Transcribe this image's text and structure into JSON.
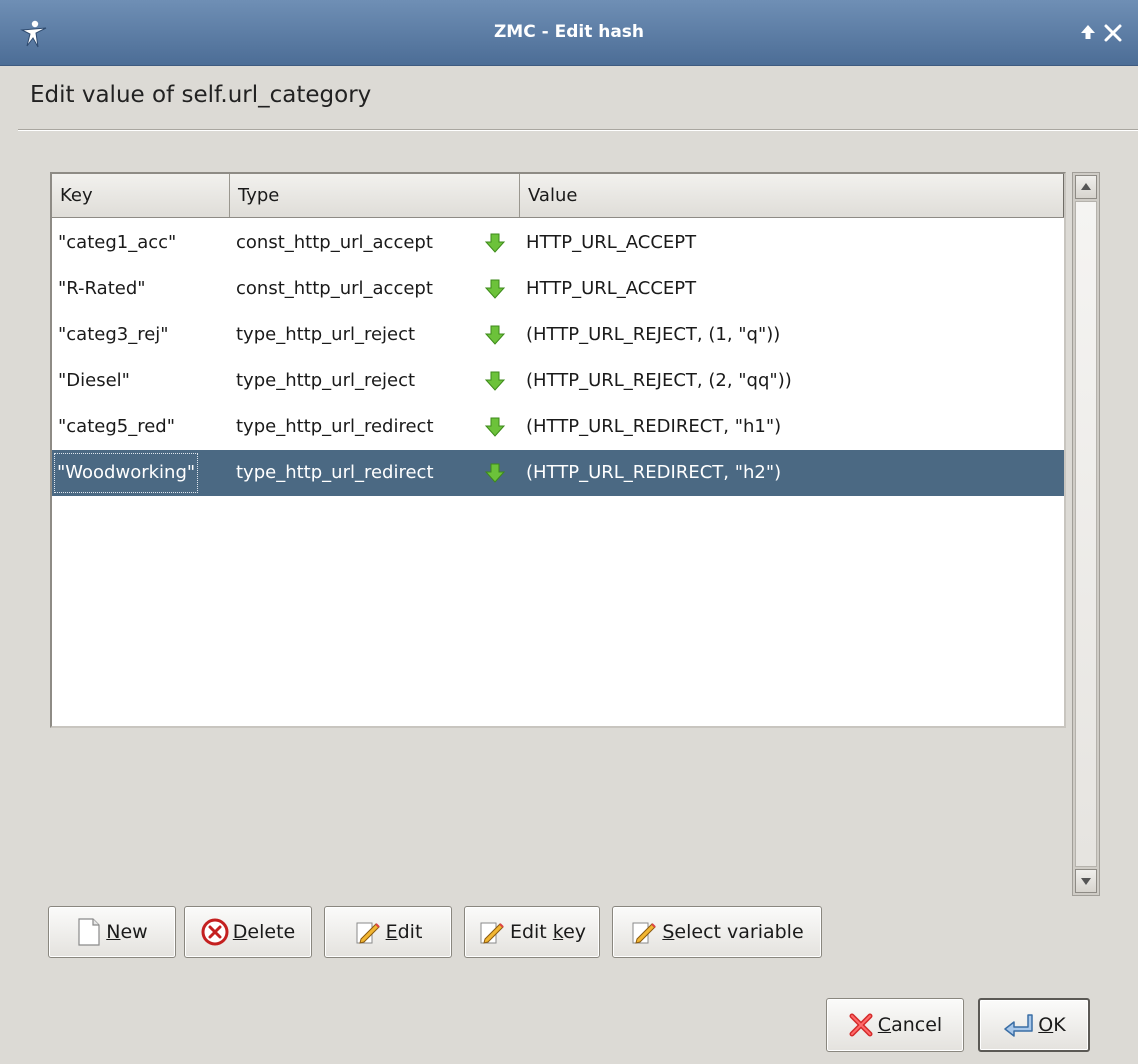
{
  "window": {
    "title": "ZMC - Edit hash",
    "icons": {
      "app": "zorp-figure-icon",
      "maximize": "up-arrow-icon",
      "close": "close-icon"
    }
  },
  "heading": "Edit value of self.url_category",
  "table": {
    "columns": [
      "Key",
      "Type",
      "Value"
    ],
    "rows": [
      {
        "key": "\"categ1_acc\"",
        "type": "const_http_url_accept",
        "value": "HTTP_URL_ACCEPT"
      },
      {
        "key": "\"R-Rated\"",
        "type": "const_http_url_accept",
        "value": "HTTP_URL_ACCEPT"
      },
      {
        "key": "\"categ3_rej\"",
        "type": "type_http_url_reject",
        "value": "(HTTP_URL_REJECT, (1, \"q\"))"
      },
      {
        "key": "\"Diesel\"",
        "type": "type_http_url_reject",
        "value": "(HTTP_URL_REJECT, (2, \"qq\"))"
      },
      {
        "key": "\"categ5_red\"",
        "type": "type_http_url_redirect",
        "value": "(HTTP_URL_REDIRECT, \"h1\")"
      },
      {
        "key": "\"Woodworking\"",
        "type": "type_http_url_redirect",
        "value": "(HTTP_URL_REDIRECT, \"h2\")"
      }
    ],
    "selected_row": 5,
    "row_icon": "green-down-arrow-icon"
  },
  "buttons": {
    "new": {
      "mnemonic": "N",
      "rest": "ew"
    },
    "delete": {
      "mnemonic": "D",
      "rest": "elete"
    },
    "edit": {
      "mnemonic": "E",
      "rest": "dit"
    },
    "edit_key": {
      "before": "Edit ",
      "mnemonic": "k",
      "rest": "ey"
    },
    "select_variable": {
      "mnemonic": "S",
      "rest": "elect variable"
    },
    "cancel": {
      "mnemonic": "C",
      "rest": "ancel"
    },
    "ok": {
      "mnemonic": "O",
      "rest": "K"
    }
  },
  "colors": {
    "titlebar": "#5a7aa3",
    "selection": "#4b6983",
    "window_bg": "#dcdad5",
    "arrow_green": "#6cc23a"
  }
}
